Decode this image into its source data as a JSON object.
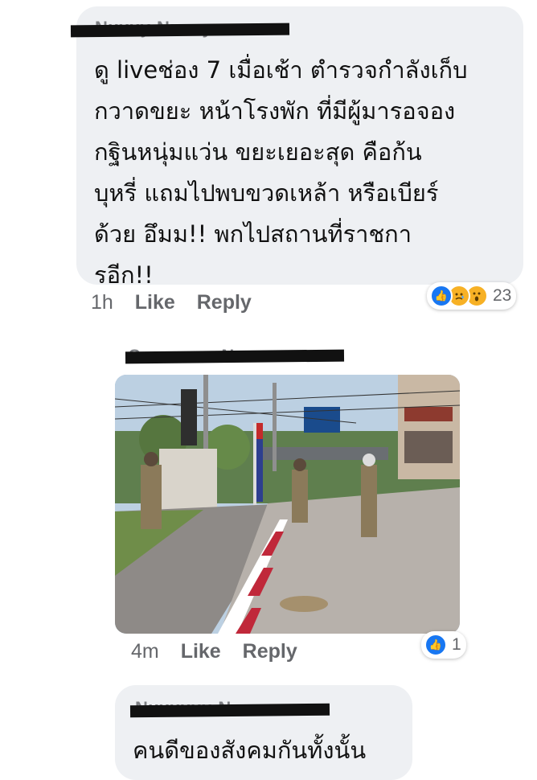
{
  "comments": [
    {
      "author_redacted": true,
      "text": "ดู liveช่อง 7 เมื่อเช้า ตำรวจกำลังเก็บ\nกวาดขยะ หน้าโรงพัก ที่มีผู้มารอจอง\nกฐินหนุ่มแว่น ขยะเยอะสุด คือก้น\nบุหรี่ แถมไปพบขวดเหล้า หรือเบียร์\nด้วย อึมม!! พกไปสถานที่ราชกา\nรอีก!!",
      "time": "1h",
      "like_label": "Like",
      "reply_label": "Reply",
      "reactions": {
        "icons": [
          "like-icon",
          "sad-icon",
          "wow-icon"
        ],
        "count": "23"
      }
    },
    {
      "author_redacted": true,
      "image": "photo-police-sweeping",
      "time": "4m",
      "like_label": "Like",
      "reply_label": "Reply",
      "reactions": {
        "icons": [
          "like-icon"
        ],
        "count": "1"
      }
    },
    {
      "author_redacted": true,
      "text": "คนดีของสังคมกันทั้งนั้น"
    }
  ],
  "colors": {
    "bubble": "#eef0f3",
    "meta": "#65676b",
    "like_blue": "#1877f2",
    "reaction_yellow": "#f7b125"
  }
}
